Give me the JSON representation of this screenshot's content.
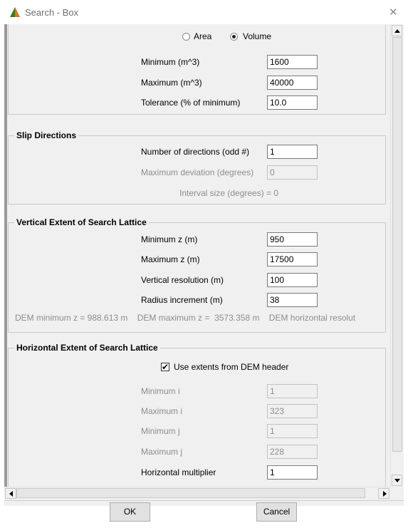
{
  "window": {
    "title": "Search - Box",
    "close_icon": "close-icon"
  },
  "colors": {
    "app_icon_green": "#2e7d32",
    "app_icon_orange": "#d87a1c"
  },
  "search_type": {
    "options": [
      "Area",
      "Volume"
    ],
    "selected": "Volume",
    "area_label": "Area",
    "volume_label": "Volume",
    "minimum_label": "Minimum (m^3)",
    "minimum_value": "1600",
    "maximum_label": "Maximum (m^3)",
    "maximum_value": "40000",
    "tolerance_label": "Tolerance (% of minimum)",
    "tolerance_value": "10.0"
  },
  "slip_directions": {
    "title": "Slip Directions",
    "number_label": "Number of directions (odd #)",
    "number_value": "1",
    "max_dev_label": "Maximum deviation (degrees)",
    "max_dev_value": "0",
    "interval_text": "Interval size (degrees) = 0"
  },
  "vertical_extent": {
    "title": "Vertical Extent of Search Lattice",
    "min_z_label": "Minimum z (m)",
    "min_z_value": "950",
    "max_z_label": "Maximum z (m)",
    "max_z_value": "17500",
    "vres_label": "Vertical resolution  (m)",
    "vres_value": "100",
    "radius_label": "Radius increment  (m)",
    "radius_value": "38",
    "dem_info": "DEM minimum z = 988.613 m    DEM maximum z =  3573.358 m    DEM horizontal resolut"
  },
  "horizontal_extent": {
    "title": "Horizontal Extent of Search Lattice",
    "use_extents_label": "Use extents from DEM header",
    "use_extents_checked": true,
    "min_i_label": "Minimum i",
    "min_i_value": "1",
    "max_i_label": "Maximum i",
    "max_i_value": "323",
    "min_j_label": "Minimum j",
    "min_j_value": "1",
    "max_j_label": "Maximum j",
    "max_j_value": "228",
    "hmult_label": "Horizontal multiplier",
    "hmult_value": "1"
  },
  "buttons": {
    "ok": "OK",
    "cancel": "Cancel"
  }
}
